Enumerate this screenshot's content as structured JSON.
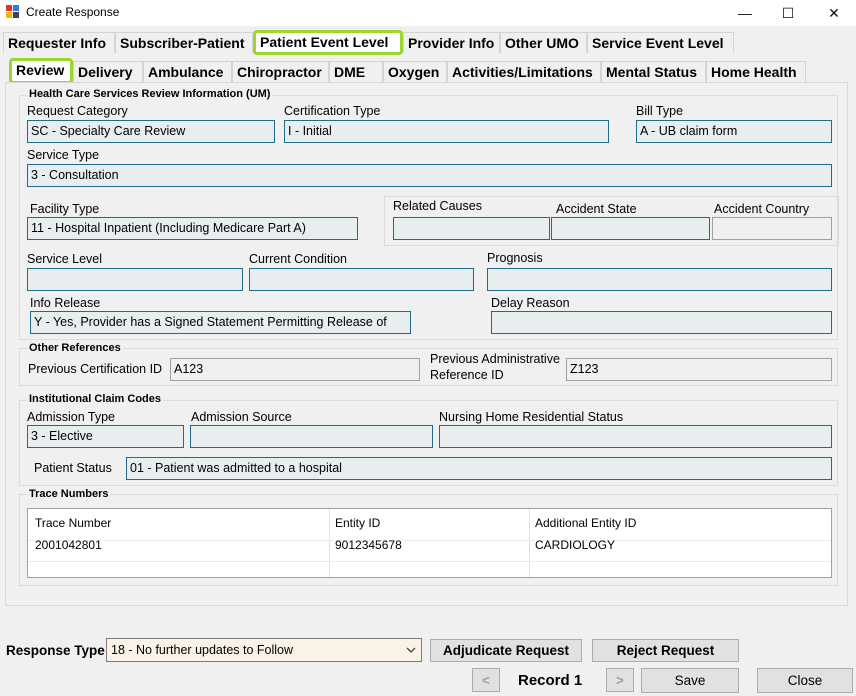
{
  "window": {
    "title": "Create Response",
    "minimize": "—",
    "maximize": "☐",
    "close": "✕"
  },
  "tabs_top": [
    "Requester Info",
    "Subscriber-Patient",
    "Patient Event Level",
    "Provider Info",
    "Other UMO",
    "Service Event Level"
  ],
  "tabs_sub": [
    "Review",
    "Delivery",
    "Ambulance",
    "Chiropractor",
    "DME",
    "Oxygen",
    "Activities/Limitations",
    "Mental Status",
    "Home Health"
  ],
  "review": {
    "group_title": "Health Care Services Review Information (UM)",
    "request_category_label": "Request Category",
    "request_category": "SC - Specialty Care Review",
    "certification_type_label": "Certification Type",
    "certification_type": "I - Initial",
    "bill_type_label": "Bill Type",
    "bill_type": "A - UB claim form",
    "service_type_label": "Service Type",
    "service_type": "3 - Consultation",
    "facility_type_label": "Facility Type",
    "facility_type": "11 - Hospital Inpatient (Including Medicare Part A)",
    "related_causes_label": "Related Causes",
    "related_causes": "",
    "accident_state_label": "Accident State",
    "accident_state": "",
    "accident_country_label": "Accident Country",
    "accident_country": "",
    "service_level_label": "Service Level",
    "service_level": "",
    "current_condition_label": "Current Condition",
    "current_condition": "",
    "prognosis_label": "Prognosis",
    "prognosis": "",
    "info_release_label": "Info Release",
    "info_release": "Y - Yes, Provider has a Signed Statement Permitting Release of",
    "delay_reason_label": "Delay Reason",
    "delay_reason": ""
  },
  "other_references": {
    "group_title": "Other References",
    "prev_cert_label": "Previous Certification ID",
    "prev_cert": "A123",
    "prev_admin_label_1": "Previous Administrative",
    "prev_admin_label_2": "Reference ID",
    "prev_admin": "Z123"
  },
  "institutional": {
    "group_title": "Institutional Claim Codes",
    "admission_type_label": "Admission Type",
    "admission_type": "3 - Elective",
    "admission_source_label": "Admission Source",
    "admission_source": "",
    "nursing_home_label": "Nursing Home Residential Status",
    "nursing_home": "",
    "patient_status_label": "Patient Status",
    "patient_status": "01 - Patient was admitted to a hospital"
  },
  "trace": {
    "group_title": "Trace Numbers",
    "columns": [
      "Trace Number",
      "Entity ID",
      "Additional Entity ID"
    ],
    "rows": [
      [
        "2001042801",
        "9012345678",
        "CARDIOLOGY"
      ]
    ]
  },
  "footer": {
    "response_type_label": "Response Type",
    "response_type": "18 - No further updates to Follow",
    "adjudicate": "Adjudicate Request",
    "reject": "Reject Request",
    "prev": "<",
    "record": "Record 1",
    "next": ">",
    "save": "Save",
    "close": "Close"
  }
}
